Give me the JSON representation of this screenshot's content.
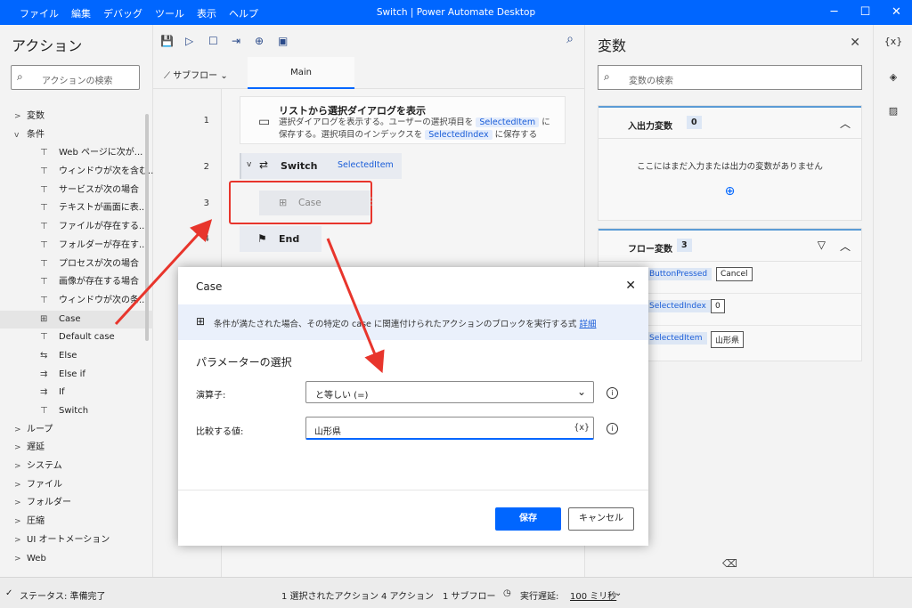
{
  "titlebar": {
    "menu": [
      "ファイル",
      "編集",
      "デバッグ",
      "ツール",
      "表示",
      "ヘルプ"
    ],
    "title": "Switch | Power Automate Desktop",
    "min": "─",
    "max": "☐",
    "close": "✕"
  },
  "actions": {
    "title": "アクション",
    "search_placeholder": "アクションの検索",
    "tree": [
      {
        "type": "cat",
        "chev": ">",
        "label": "変数"
      },
      {
        "type": "cat",
        "chev": "v",
        "label": "条件"
      },
      {
        "type": "sub",
        "label": "Web ページに次が..."
      },
      {
        "type": "sub",
        "label": "ウィンドウが次を含む..."
      },
      {
        "type": "sub",
        "label": "サービスが次の場合"
      },
      {
        "type": "sub",
        "label": "テキストが画面に表..."
      },
      {
        "type": "sub",
        "label": "ファイルが存在する..."
      },
      {
        "type": "sub",
        "label": "フォルダーが存在す..."
      },
      {
        "type": "sub",
        "label": "プロセスが次の場合"
      },
      {
        "type": "sub",
        "label": "画像が存在する場合"
      },
      {
        "type": "sub",
        "label": "ウィンドウが次の条..."
      },
      {
        "type": "sub",
        "label": "Case",
        "selected": true
      },
      {
        "type": "sub",
        "label": "Default case"
      },
      {
        "type": "sub",
        "label": "Else"
      },
      {
        "type": "sub",
        "label": "Else if"
      },
      {
        "type": "sub",
        "label": "If"
      },
      {
        "type": "sub",
        "label": "Switch"
      },
      {
        "type": "cat",
        "chev": ">",
        "label": "ループ"
      },
      {
        "type": "cat",
        "chev": ">",
        "label": "遅延"
      },
      {
        "type": "cat",
        "chev": ">",
        "label": "システム"
      },
      {
        "type": "cat",
        "chev": ">",
        "label": "ファイル"
      },
      {
        "type": "cat",
        "chev": ">",
        "label": "フォルダー"
      },
      {
        "type": "cat",
        "chev": ">",
        "label": "圧縮"
      },
      {
        "type": "cat",
        "chev": ">",
        "label": "UI オートメーション"
      },
      {
        "type": "cat",
        "chev": ">",
        "label": "Web"
      }
    ]
  },
  "editor": {
    "subflow_label": "サブフロー",
    "main_tab": "Main",
    "line_numbers": [
      "1",
      "2",
      "3",
      "4"
    ],
    "step1_title": "リストから選択ダイアログを表示",
    "step1_desc_a": "選択ダイアログを表示する。ユーザーの選択項目を",
    "step1_var1": "SelectedItem",
    "step1_desc_b": "に保存する。選択項目のインデックスを",
    "step1_var2": "SelectedIndex",
    "step1_desc_c": "に保存する",
    "step2_title": "Switch",
    "step2_var": "SelectedItem",
    "step3_title": "Case",
    "step4_title": "End"
  },
  "variables": {
    "title": "変数",
    "search_placeholder": "変数の検索",
    "io_title": "入出力変数",
    "io_count": "0",
    "io_empty": "ここにはまだ入力または出力の変数がありません",
    "flow_title": "フロー変数",
    "flow_count": "3",
    "flow_vars": [
      {
        "name": "ButtonPressed",
        "value": "Cancel"
      },
      {
        "name": "SelectedIndex",
        "value": "0"
      },
      {
        "name": "SelectedItem",
        "value": "山形県"
      }
    ]
  },
  "dialog": {
    "title": "Case",
    "info_text": "条件が満たされた場合、その特定の case に関連付けられたアクションのブロックを実行する式",
    "info_link": "詳細",
    "section": "パラメーターの選択",
    "operator_label": "演算子:",
    "operator_value": "と等しい (=)",
    "compare_label": "比較する値:",
    "compare_value": "山形県",
    "var_button": "{x}",
    "save": "保存",
    "cancel": "キャンセル"
  },
  "status": {
    "state": "ステータス: 準備完了",
    "selected": "1 選択されたアクション",
    "actions": "4 アクション",
    "subflows": "1 サブフロー",
    "delay_label": "実行遅延:",
    "delay_value": "100 ミリ秒"
  },
  "colors": {
    "accent": "#0066ff",
    "highlight": "#e8352c"
  }
}
